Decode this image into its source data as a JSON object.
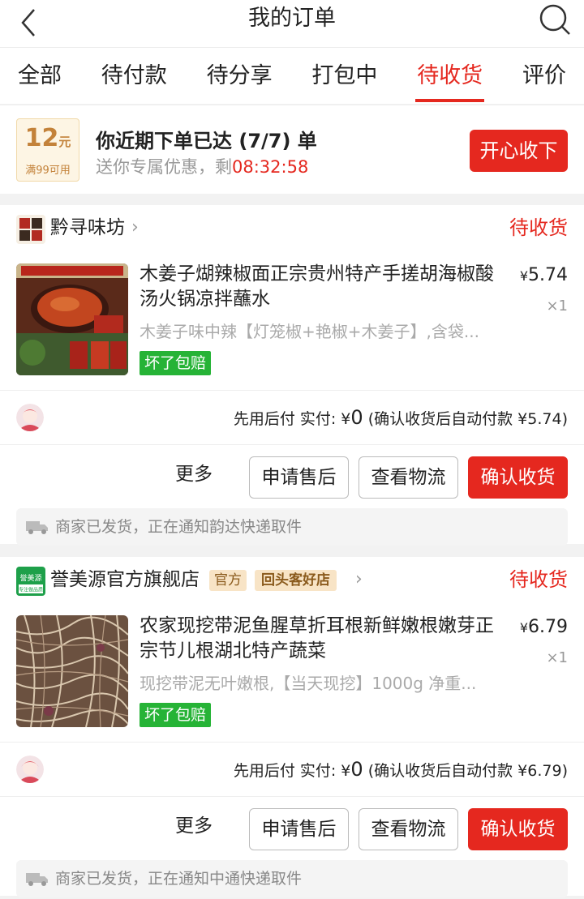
{
  "header": {
    "title": "我的订单"
  },
  "tabs": [
    {
      "label": "全部"
    },
    {
      "label": "待付款"
    },
    {
      "label": "待分享"
    },
    {
      "label": "打包中"
    },
    {
      "label": "待收货",
      "active": true
    },
    {
      "label": "评价"
    }
  ],
  "promo": {
    "coupon_amount": "12",
    "coupon_unit": "元",
    "coupon_condition": "满99可用",
    "title": "你近期下单已达 (7/7) 单",
    "subtitle": "送你专属优惠，剩",
    "countdown": "08:32:58",
    "button": "开心收下"
  },
  "orders": [
    {
      "shop_name": "黔寻味坊",
      "status": "待收货",
      "product_title": "木姜子煳辣椒面正宗贵州特产手搓胡海椒酸汤火锅凉拌蘸水",
      "price_symbol": "¥",
      "price": "5.74",
      "quantity": "×1",
      "sku": "木姜子味中辣【灯笼椒+艳椒+木姜子】,含袋...",
      "guarantee": "坏了包赔",
      "pay_prefix": "先用后付 实付: ¥",
      "pay_amount": "0",
      "pay_suffix": " (确认收货后自动付款 ¥5.74)",
      "more": "更多",
      "btn_aftersale": "申请售后",
      "btn_logistics": "查看物流",
      "btn_confirm": "确认收货",
      "logistics_text": "商家已发货，正在通知韵达快递取件"
    },
    {
      "shop_name": "誉美源官方旗舰店",
      "tag_official": "官方",
      "tag_repeat": "回头客好店",
      "status": "待收货",
      "product_title": "农家现挖带泥鱼腥草折耳根新鲜嫩根嫩芽正宗节儿根湖北特产蔬菜",
      "price_symbol": "¥",
      "price": "6.79",
      "quantity": "×1",
      "sku": "现挖带泥无叶嫩根,【当天现挖】1000g 净重...",
      "guarantee": "坏了包赔",
      "pay_prefix": "先用后付 实付: ¥",
      "pay_amount": "0",
      "pay_suffix": " (确认收货后自动付款 ¥6.79)",
      "more": "更多",
      "btn_aftersale": "申请售后",
      "btn_logistics": "查看物流",
      "btn_confirm": "确认收货",
      "logistics_text": "商家已发货，正在通知中通快递取件"
    }
  ],
  "shop_logo_text": {
    "brand": "誉美源",
    "slogan": "专注做品质"
  },
  "colors": {
    "accent": "#e5281f",
    "guarantee": "#26b336",
    "coupon": "#c3823a"
  },
  "icons": {
    "back": "chevron-left-icon",
    "search": "search-icon",
    "truck": "truck-icon",
    "arrow": "chevron-right-icon"
  }
}
